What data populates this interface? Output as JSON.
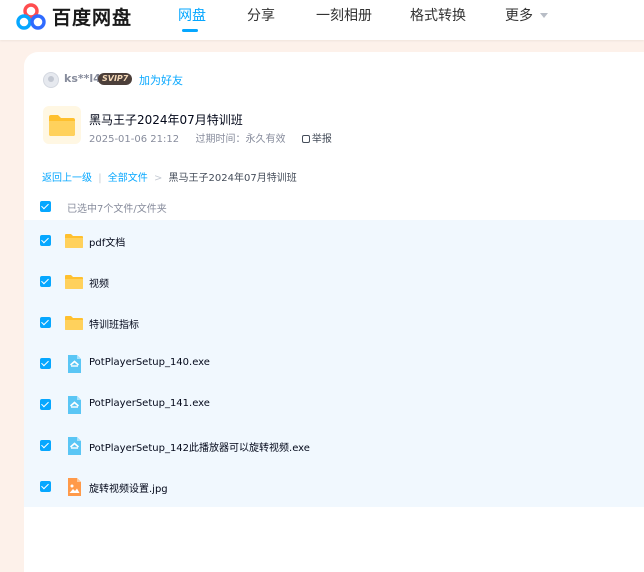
{
  "app": {
    "brand": "百度网盘",
    "nav": [
      "网盘",
      "分享",
      "一刻相册",
      "格式转换",
      "更多"
    ],
    "active_nav": "网盘",
    "accent": "#06a7ff"
  },
  "sharer": {
    "username": "ks**l4",
    "badge": "SVIP7",
    "add_friend": "加为好友"
  },
  "share": {
    "title": "黑马王子2024年07月特训班",
    "date": "2025-01-06 21:12",
    "expiry": "过期时间：永久有效",
    "report": "举报"
  },
  "breadcrumb": {
    "back": "返回上一级",
    "sep1": "|",
    "all": "全部文件",
    "sep2": ">",
    "current": "黑马王子2024年07月特训班"
  },
  "selection": {
    "label": "已选中7个文件/文件夹"
  },
  "files": [
    {
      "name": "pdf文档",
      "icon": "folder-icon"
    },
    {
      "name": "视频",
      "icon": "folder-icon"
    },
    {
      "name": "特训班指标",
      "icon": "folder-icon"
    },
    {
      "name": "PotPlayerSetup_140.exe",
      "icon": "exe-file-icon"
    },
    {
      "name": "PotPlayerSetup_141.exe",
      "icon": "exe-file-icon"
    },
    {
      "name": "PotPlayerSetup_142此播放器可以旋转视频.exe",
      "icon": "exe-file-icon"
    },
    {
      "name": "旋转视频设置.jpg",
      "icon": "image-file-icon"
    }
  ]
}
